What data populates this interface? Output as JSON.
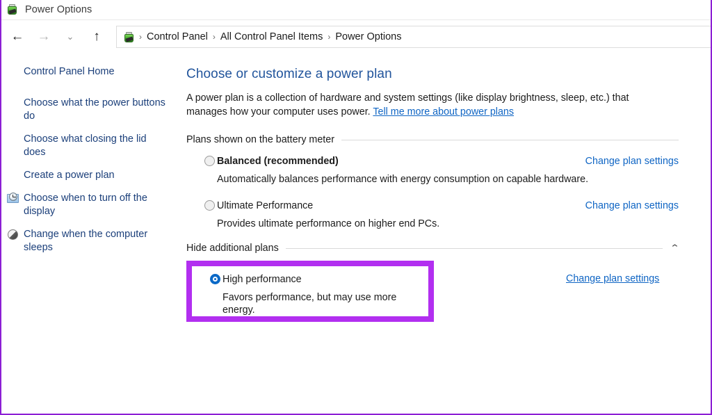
{
  "window": {
    "title": "Power Options",
    "app_icon": "power-plug-icon",
    "border_color": "#8c1fd4"
  },
  "nav": {
    "back": "←",
    "forward": "→",
    "recent": "⌄",
    "up": "↑"
  },
  "breadcrumb": {
    "icon": "power-plug-icon",
    "separator": "›",
    "items": [
      "Control Panel",
      "All Control Panel Items",
      "Power Options"
    ]
  },
  "sidebar": {
    "items": [
      {
        "label": "Control Panel Home",
        "icon": null
      },
      {
        "label": "Choose what the power buttons do",
        "icon": null
      },
      {
        "label": "Choose what closing the lid does",
        "icon": null
      },
      {
        "label": "Create a power plan",
        "icon": null
      },
      {
        "label": "Choose when to turn off the display",
        "icon": "display-clock-icon"
      },
      {
        "label": "Change when the computer sleeps",
        "icon": "sleep-sphere-icon"
      }
    ]
  },
  "main": {
    "page_title": "Choose or customize a power plan",
    "intro_text_1": "A power plan is a collection of hardware and system settings (like display brightness, sleep, etc.) that manages how your computer uses power. ",
    "intro_link": "Tell me more about power plans",
    "sections": [
      {
        "heading": "Plans shown on the battery meter",
        "chevron": null,
        "plans": [
          {
            "name": "Balanced (recommended)",
            "bold": true,
            "selected": false,
            "description": "Automatically balances performance with energy consumption on capable hardware.",
            "link": "Change plan settings"
          },
          {
            "name": "Ultimate Performance",
            "bold": false,
            "selected": false,
            "description": "Provides ultimate performance on higher end PCs.",
            "link": "Change plan settings"
          }
        ]
      },
      {
        "heading": "Hide additional plans",
        "chevron": "⌃",
        "plans": [
          {
            "name": "High performance",
            "bold": false,
            "selected": true,
            "description": "Favors performance, but may use more energy.",
            "link": "Change plan settings",
            "highlighted": true
          }
        ]
      }
    ]
  },
  "colors": {
    "annotation": "#b22ff0",
    "link": "#0f65c4",
    "heading": "#22559c",
    "radio_selected": "#0b69c7"
  }
}
